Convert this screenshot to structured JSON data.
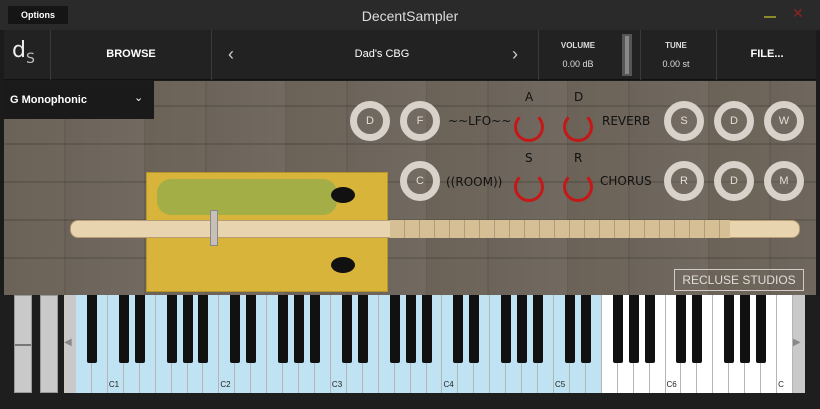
{
  "window": {
    "title": "DecentSampler",
    "options_label": "Options"
  },
  "toolbar": {
    "logo": "d",
    "logo_sub": "S",
    "browse_label": "BROWSE",
    "preset_name": "Dad's CBG",
    "volume_label": "VOLUME",
    "volume_value": "0.00 dB",
    "tune_label": "TUNE",
    "tune_value": "0.00 st",
    "file_label": "FILE..."
  },
  "mode": {
    "selected": "G Monophonic"
  },
  "knobs_row1": [
    "D",
    "F"
  ],
  "knobs_row2": [
    "C"
  ],
  "knobs_right_row1": [
    "S",
    "D",
    "W"
  ],
  "knobs_right_row2": [
    "R",
    "D",
    "M"
  ],
  "fx": {
    "lfo": "~~LFO~~",
    "room": "((ROOM))",
    "reverb": "REVERB",
    "chorus": "CHORUS"
  },
  "adsr": {
    "a": "A",
    "d": "D",
    "s": "S",
    "r": "R"
  },
  "watermark": "RECLUSE STUDIOS",
  "keyboard": {
    "octave_labels": [
      "C1",
      "C2",
      "C3",
      "C4",
      "C5",
      "C6",
      "C"
    ],
    "scroll_left": "◀",
    "scroll_right": "▶"
  }
}
